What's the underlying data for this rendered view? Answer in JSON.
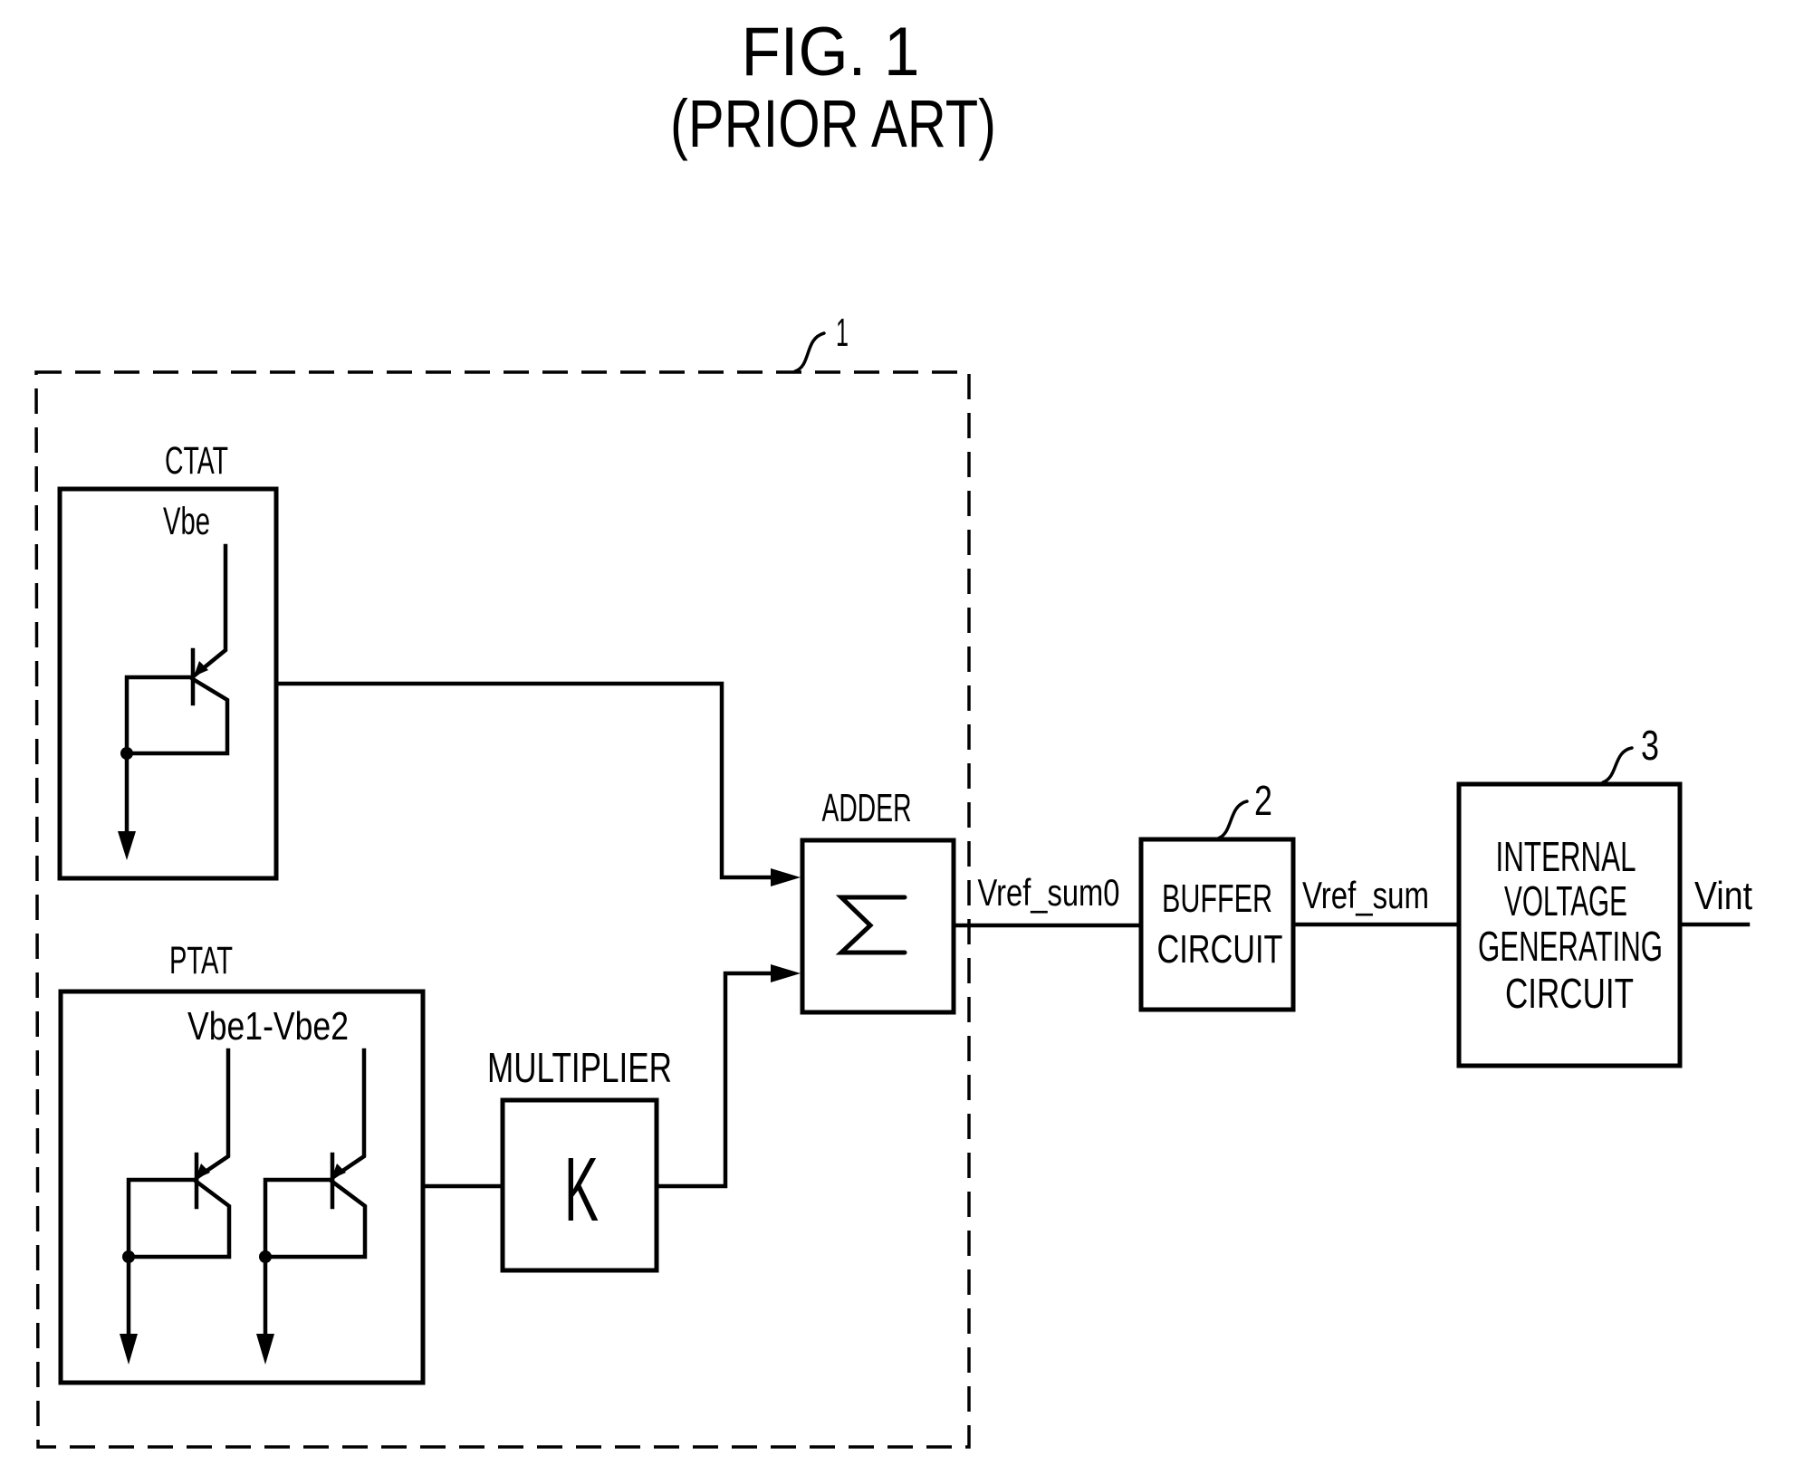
{
  "figure": {
    "title": "FIG. 1",
    "subtitle": "(PRIOR ART)"
  },
  "reference_block": {
    "ref_numeral": "1",
    "ctat": {
      "label": "CTAT",
      "signal": "Vbe",
      "icon": "pnp-transistor-icon"
    },
    "ptat": {
      "label": "PTAT",
      "signal": "Vbe1-Vbe2",
      "icons": [
        "pnp-transistor-icon",
        "pnp-transistor-icon"
      ]
    },
    "multiplier": {
      "label": "MULTIPLIER",
      "symbol": "K"
    },
    "adder": {
      "label": "ADDER",
      "symbol": "Σ"
    }
  },
  "signals": {
    "adder_out": "Vref_sum0",
    "buffer_out": "Vref_sum",
    "final_out": "Vint"
  },
  "buffer": {
    "ref_numeral": "2",
    "line1": "BUFFER",
    "line2": "CIRCUIT"
  },
  "internal_generator": {
    "ref_numeral": "3",
    "line1": "INTERNAL",
    "line2": "VOLTAGE",
    "line3": "GENERATING",
    "line4": "CIRCUIT"
  }
}
